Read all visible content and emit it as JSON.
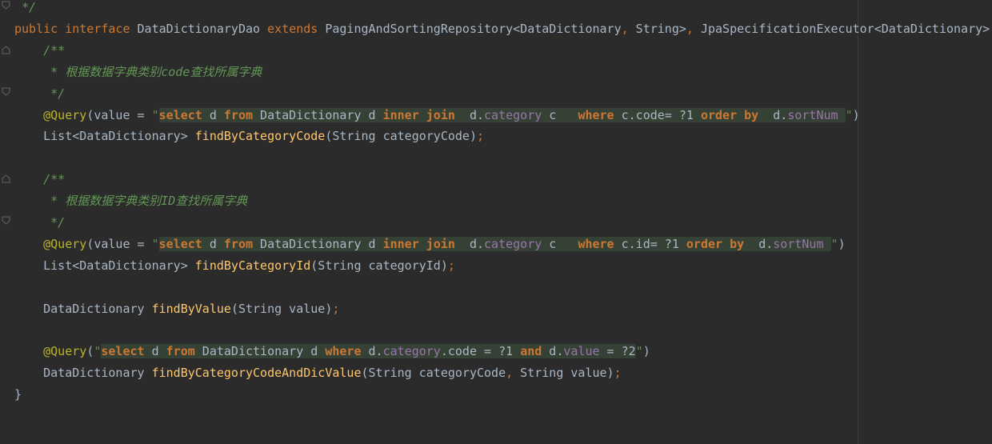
{
  "editor": {
    "lines": [
      {
        "tokens": [
          {
            "t": " */",
            "c": "cm"
          }
        ]
      },
      {
        "tokens": [
          {
            "t": "public",
            "c": "kw"
          },
          {
            "t": " ",
            "c": "plain"
          },
          {
            "t": "interface",
            "c": "kw"
          },
          {
            "t": " DataDictionaryDao ",
            "c": "plain"
          },
          {
            "t": "extends",
            "c": "kw"
          },
          {
            "t": " PagingAndSortingRepository<DataDictionary",
            "c": "plain"
          },
          {
            "t": ",",
            "c": "kw"
          },
          {
            "t": " String>",
            "c": "plain"
          },
          {
            "t": ",",
            "c": "kw"
          },
          {
            "t": " JpaSpecificationExecutor<DataDictionary> {",
            "c": "plain"
          }
        ]
      },
      {
        "tokens": [
          {
            "t": "    /**",
            "c": "cm"
          }
        ]
      },
      {
        "tokens": [
          {
            "t": "     * 根据数据字典类别code查找所属字典",
            "c": "cm"
          }
        ]
      },
      {
        "tokens": [
          {
            "t": "     */",
            "c": "cm"
          }
        ]
      },
      {
        "tokens": [
          {
            "t": "    ",
            "c": "plain"
          },
          {
            "t": "@Query",
            "c": "ann"
          },
          {
            "t": "(value = ",
            "c": "plain"
          },
          {
            "t": "\"",
            "c": "str"
          },
          {
            "t": "select",
            "c": "kwb",
            "h": true
          },
          {
            "t": " d ",
            "c": "plain",
            "h": true
          },
          {
            "t": "from",
            "c": "kwb",
            "h": true
          },
          {
            "t": " DataDictionary d ",
            "c": "plain",
            "h": true
          },
          {
            "t": "inner join",
            "c": "kwb",
            "h": true
          },
          {
            "t": "  d.",
            "c": "plain",
            "h": true
          },
          {
            "t": "category",
            "c": "fld",
            "h": true
          },
          {
            "t": " c   ",
            "c": "plain",
            "h": true
          },
          {
            "t": "where",
            "c": "kwb",
            "h": true
          },
          {
            "t": " c.code= ?1 ",
            "c": "plain",
            "h": true
          },
          {
            "t": "order by",
            "c": "kwb",
            "h": true
          },
          {
            "t": "  d.",
            "c": "plain",
            "h": true
          },
          {
            "t": "sortNum",
            "c": "fld",
            "h": true
          },
          {
            "t": " ",
            "c": "plain",
            "h": true
          },
          {
            "t": "\"",
            "c": "str"
          },
          {
            "t": ")",
            "c": "plain"
          }
        ]
      },
      {
        "tokens": [
          {
            "t": "    List<DataDictionary> ",
            "c": "plain"
          },
          {
            "t": "findByCategoryCode",
            "c": "fn"
          },
          {
            "t": "(String categoryCode)",
            "c": "plain"
          },
          {
            "t": ";",
            "c": "kw"
          }
        ]
      },
      {
        "tokens": [
          {
            "t": "",
            "c": "plain"
          }
        ]
      },
      {
        "tokens": [
          {
            "t": "    /**",
            "c": "cm"
          }
        ]
      },
      {
        "tokens": [
          {
            "t": "     * 根据数据字典类别ID查找所属字典",
            "c": "cm"
          }
        ]
      },
      {
        "tokens": [
          {
            "t": "     */",
            "c": "cm"
          }
        ]
      },
      {
        "tokens": [
          {
            "t": "    ",
            "c": "plain"
          },
          {
            "t": "@Query",
            "c": "ann"
          },
          {
            "t": "(value = ",
            "c": "plain"
          },
          {
            "t": "\"",
            "c": "str"
          },
          {
            "t": "select",
            "c": "kwb",
            "h": true
          },
          {
            "t": " d ",
            "c": "plain",
            "h": true
          },
          {
            "t": "from",
            "c": "kwb",
            "h": true
          },
          {
            "t": " DataDictionary d ",
            "c": "plain",
            "h": true
          },
          {
            "t": "inner join",
            "c": "kwb",
            "h": true
          },
          {
            "t": "  d.",
            "c": "plain",
            "h": true
          },
          {
            "t": "category",
            "c": "fld",
            "h": true
          },
          {
            "t": " c   ",
            "c": "plain",
            "h": true
          },
          {
            "t": "where",
            "c": "kwb",
            "h": true
          },
          {
            "t": " c.id= ?1 ",
            "c": "plain",
            "h": true
          },
          {
            "t": "order by",
            "c": "kwb",
            "h": true
          },
          {
            "t": "  d.",
            "c": "plain",
            "h": true
          },
          {
            "t": "sortNum",
            "c": "fld",
            "h": true
          },
          {
            "t": " ",
            "c": "plain",
            "h": true
          },
          {
            "t": "\"",
            "c": "str"
          },
          {
            "t": ")",
            "c": "plain"
          }
        ]
      },
      {
        "tokens": [
          {
            "t": "    List<DataDictionary> ",
            "c": "plain"
          },
          {
            "t": "findByCategoryId",
            "c": "fn"
          },
          {
            "t": "(String categoryId)",
            "c": "plain"
          },
          {
            "t": ";",
            "c": "kw"
          }
        ]
      },
      {
        "tokens": [
          {
            "t": "",
            "c": "plain"
          }
        ]
      },
      {
        "tokens": [
          {
            "t": "    DataDictionary ",
            "c": "plain"
          },
          {
            "t": "findByValue",
            "c": "fn"
          },
          {
            "t": "(String value)",
            "c": "plain"
          },
          {
            "t": ";",
            "c": "kw"
          }
        ]
      },
      {
        "tokens": [
          {
            "t": "",
            "c": "plain"
          }
        ]
      },
      {
        "tokens": [
          {
            "t": "    ",
            "c": "plain"
          },
          {
            "t": "@Query",
            "c": "ann"
          },
          {
            "t": "(",
            "c": "plain"
          },
          {
            "t": "\"",
            "c": "str"
          },
          {
            "t": "select",
            "c": "kwb",
            "h": true
          },
          {
            "t": " d ",
            "c": "plain",
            "h": true
          },
          {
            "t": "from",
            "c": "kwb",
            "h": true
          },
          {
            "t": " DataDictionary d ",
            "c": "plain",
            "h": true
          },
          {
            "t": "where",
            "c": "kwb",
            "h": true
          },
          {
            "t": " d.",
            "c": "plain",
            "h": true
          },
          {
            "t": "category",
            "c": "fld",
            "h": true
          },
          {
            "t": ".code = ?1 ",
            "c": "plain",
            "h": true
          },
          {
            "t": "and",
            "c": "kwb",
            "h": true
          },
          {
            "t": " d.",
            "c": "plain",
            "h": true
          },
          {
            "t": "value",
            "c": "fld",
            "h": true
          },
          {
            "t": " = ?2",
            "c": "plain",
            "h": true
          },
          {
            "t": "\"",
            "c": "str"
          },
          {
            "t": ")",
            "c": "plain"
          }
        ]
      },
      {
        "tokens": [
          {
            "t": "    DataDictionary ",
            "c": "plain"
          },
          {
            "t": "findByCategoryCodeAndDicValue",
            "c": "fn"
          },
          {
            "t": "(String categoryCode",
            "c": "plain"
          },
          {
            "t": ",",
            "c": "kw"
          },
          {
            "t": " String value)",
            "c": "plain"
          },
          {
            "t": ";",
            "c": "kw"
          }
        ]
      },
      {
        "tokens": [
          {
            "t": "}",
            "c": "plain"
          }
        ]
      }
    ],
    "colors": {
      "background": "#2b2b2b",
      "keyword": "#cc7832",
      "comment": "#629755",
      "annotation": "#bbb529",
      "method": "#ffc66d",
      "string": "#6a8759",
      "field": "#9876aa",
      "injection_bg": "#364135"
    },
    "fold_icons": [
      "fold-close-icon",
      "fold-open-icon",
      "fold-close-icon",
      "fold-open-icon",
      "fold-close-icon"
    ]
  }
}
